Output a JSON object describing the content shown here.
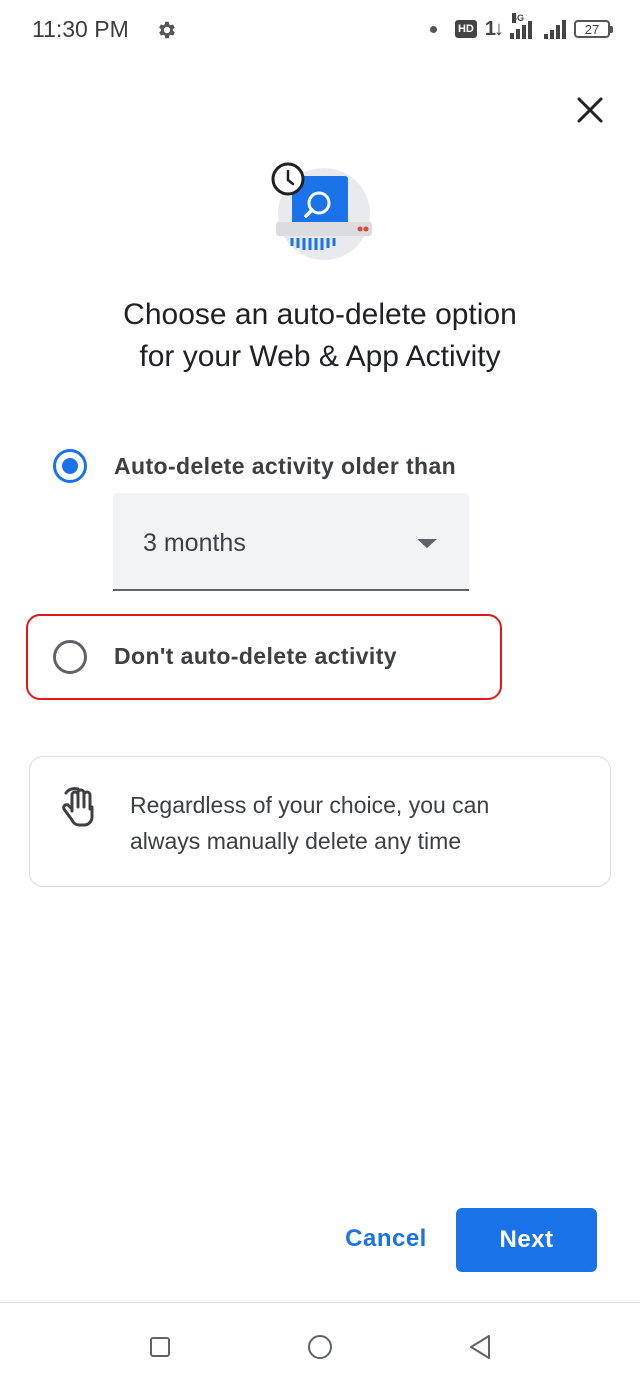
{
  "status_bar": {
    "time": "11:30 PM",
    "hd_label": "HD",
    "data_arrows": "1↓",
    "network_label": "4G",
    "battery_level": "27"
  },
  "dialog": {
    "title_line1": "Choose an auto-delete option",
    "title_line2": "for your Web & App Activity",
    "options": [
      {
        "label": "Auto-delete activity older than",
        "selected": true
      },
      {
        "label": "Don't auto-delete activity",
        "selected": false
      }
    ],
    "dropdown": {
      "value": "3 months"
    },
    "info": {
      "line1": "Regardless of your choice, you can",
      "line2": "always manually delete any time"
    },
    "buttons": {
      "cancel_label": "Cancel",
      "next_label": "Next"
    }
  },
  "icons": {
    "close": "close-icon",
    "illustration": "auto-delete-illustration",
    "info": "hand-icon",
    "settings": "gear-icon",
    "nav": [
      "recents-icon",
      "home-icon",
      "back-icon"
    ]
  },
  "colors": {
    "accent": "#1a73e8",
    "highlight": "#e01818",
    "text_primary": "#202124",
    "text_secondary": "#3c4043",
    "dropdown_bg": "#f1f3f4",
    "card_border": "#dadce0"
  }
}
